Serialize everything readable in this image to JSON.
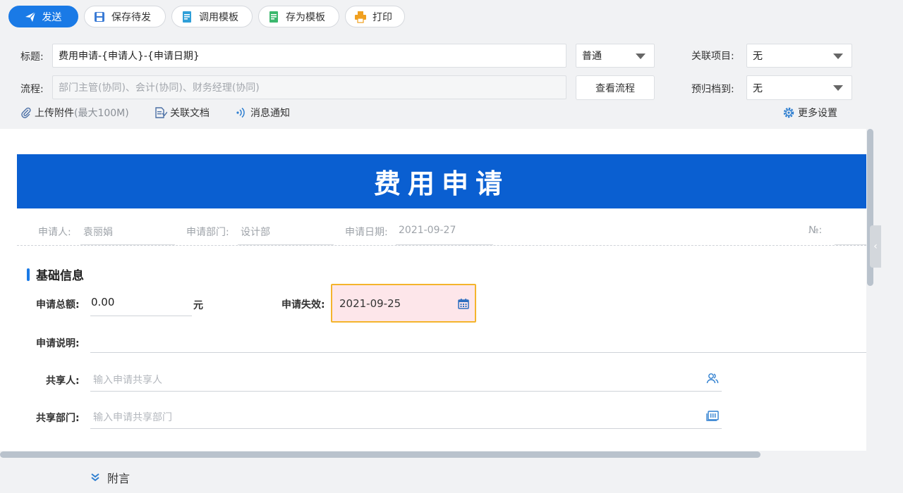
{
  "toolbar": {
    "send": "发送",
    "save_draft": "保存待发",
    "use_template": "调用模板",
    "save_template": "存为模板",
    "print": "打印"
  },
  "header": {
    "title_label": "标题:",
    "title_value": "费用申请-{申请人}-{申请日期}",
    "priority_value": "普通",
    "related_project_label": "关联项目:",
    "related_project_value": "无",
    "flow_label": "流程:",
    "flow_value": "部门主管(协同)、会计(协同)、财务经理(协同)",
    "view_flow": "查看流程",
    "archive_label": "预归档到:",
    "archive_value": "无",
    "upload": "上传附件",
    "upload_limit": "(最大100M)",
    "related_doc": "关联文档",
    "notify": "消息通知",
    "more_settings": "更多设置"
  },
  "form": {
    "banner_title": "费用申请",
    "applicant_label": "申请人:",
    "applicant_value": "袁丽娟",
    "dept_label": "申请部门:",
    "dept_value": "设计部",
    "date_label": "申请日期:",
    "date_value": "2021-09-27",
    "no_label": "№:",
    "section_title": "基础信息",
    "amount_label": "申请总额:",
    "amount_value": "0.00",
    "amount_unit": "元",
    "expire_label": "申请失效:",
    "expire_value": "2021-09-25",
    "desc_label": "申请说明:",
    "share_person_label": "共享人:",
    "share_person_placeholder": "输入申请共享人",
    "share_dept_label": "共享部门:",
    "share_dept_placeholder": "输入申请共享部门"
  },
  "footer": {
    "attach_comment": "附言"
  },
  "colors": {
    "primary": "#1a7ae6",
    "banner": "#0a5fd1",
    "highlight_border": "#f4b42c",
    "highlight_fill": "#fde6ea"
  }
}
